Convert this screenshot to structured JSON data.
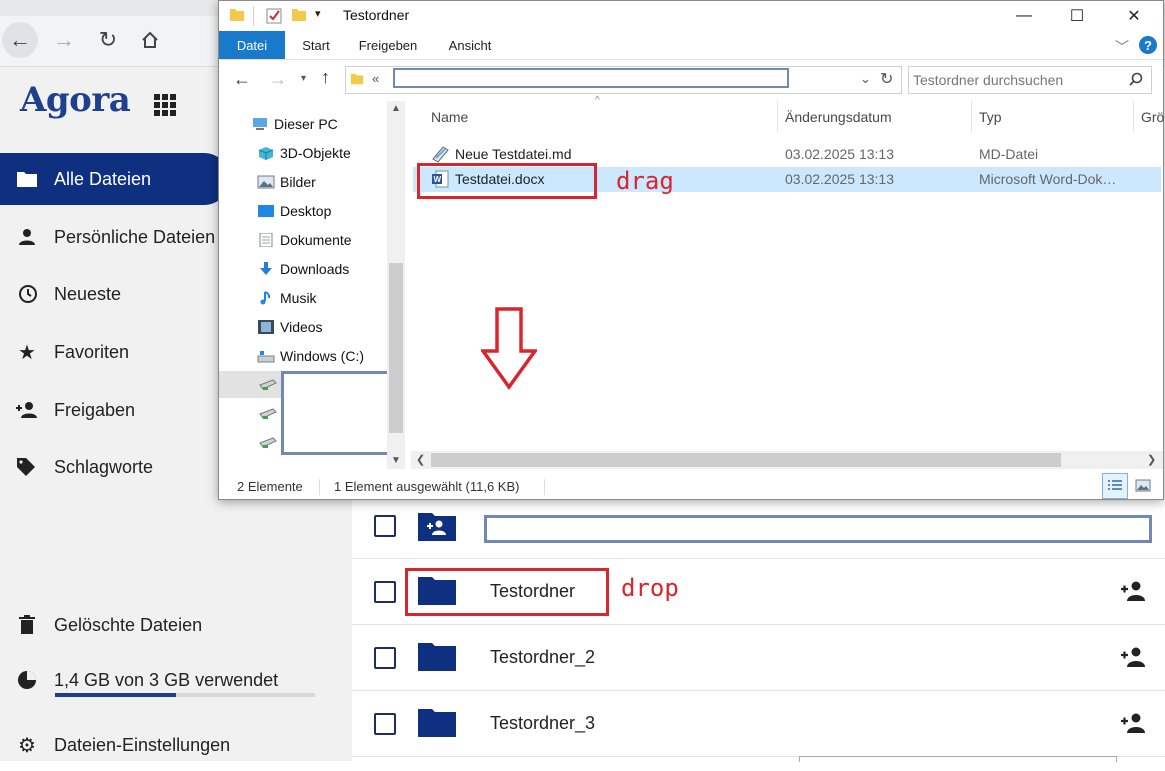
{
  "browser": {
    "back_icon": "←",
    "forward_icon": "→",
    "reload_icon": "↻",
    "home_icon": "home-icon"
  },
  "app": {
    "logo": "Agora",
    "nav": [
      {
        "label": "Alle Dateien",
        "icon": "folder-icon",
        "active": true
      },
      {
        "label": "Persönliche Dateien",
        "icon": "person-icon"
      },
      {
        "label": "Neueste",
        "icon": "history-icon"
      },
      {
        "label": "Favoriten",
        "icon": "star-icon"
      },
      {
        "label": "Freigaben",
        "icon": "person-add-icon"
      },
      {
        "label": "Schlagworte",
        "icon": "tag-icon"
      }
    ],
    "trash_label": "Gelöschte Dateien",
    "quota_label": "1,4 GB von 3 GB verwendet",
    "quota_fraction": 0.4667,
    "settings_label": "Dateien-Einstellungen",
    "files": [
      {
        "name": ""
      },
      {
        "name": "Testordner"
      },
      {
        "name": "Testordner_2"
      },
      {
        "name": "Testordner_3"
      }
    ],
    "accent": "#0f2f80"
  },
  "explorer": {
    "title": "Testordner",
    "minimize": "—",
    "maximize": "☐",
    "close": "✕",
    "tabs": [
      "Datei",
      "Start",
      "Freigeben",
      "Ansicht"
    ],
    "address_prefix": "«",
    "search_placeholder": "Testordner durchsuchen",
    "tree": [
      "Dieser PC",
      "3D-Objekte",
      "Bilder",
      "Desktop",
      "Dokumente",
      "Downloads",
      "Musik",
      "Videos",
      "Windows (C:)"
    ],
    "columns": [
      "Name",
      "Änderungsdatum",
      "Typ",
      "Grö"
    ],
    "files": [
      {
        "name": "Neue Testdatei.md",
        "date": "03.02.2025 13:13",
        "type": "MD-Datei"
      },
      {
        "name": "Testdatei.docx",
        "date": "03.02.2025 13:13",
        "type": "Microsoft Word-Dok…"
      }
    ],
    "status_count": "2 Elemente",
    "status_selected": "1 Element ausgewählt (11,6 KB)"
  },
  "annotations": {
    "drag": "drag",
    "drop": "drop",
    "color": "#d9262e"
  }
}
